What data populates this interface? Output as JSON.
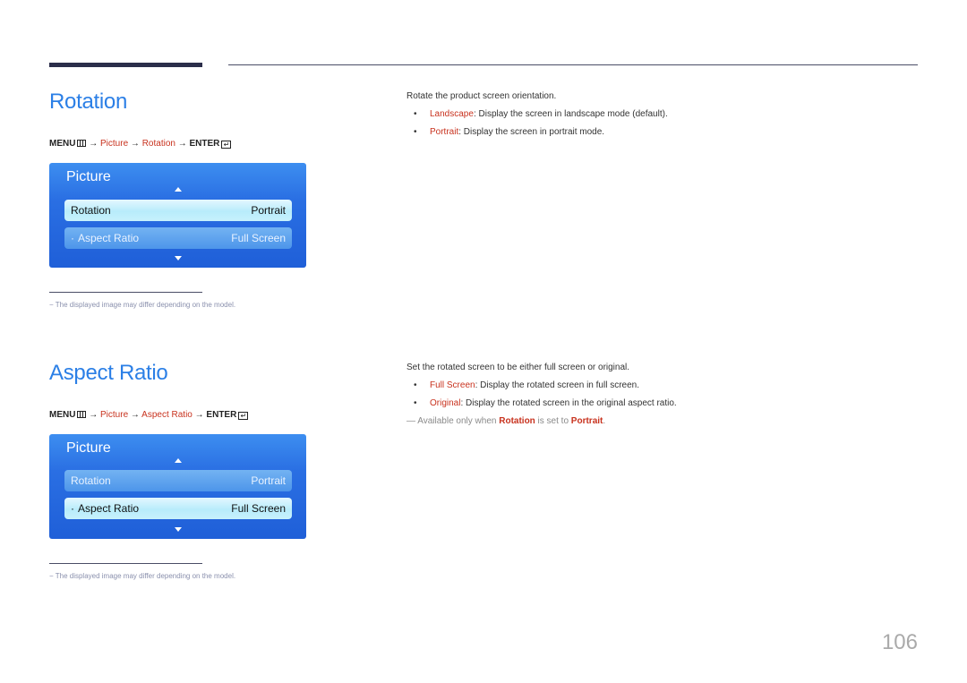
{
  "sections": {
    "rotation": {
      "title": "Rotation",
      "path": {
        "menu": "MENU",
        "arrow": "→",
        "picture": "Picture",
        "item": "Rotation",
        "enter": "ENTER"
      },
      "osd": {
        "title": "Picture",
        "rows": [
          {
            "label": "Rotation",
            "value": "Portrait",
            "selected": true
          },
          {
            "label": "Aspect Ratio",
            "value": "Full Screen",
            "selected": false
          }
        ]
      },
      "footnote": "The displayed image may differ depending on the model.",
      "description": "Rotate the product screen orientation.",
      "bullets": [
        {
          "term": "Landscape",
          "text": ": Display the screen in landscape mode (default)."
        },
        {
          "term": "Portrait",
          "text": ": Display the screen in portrait mode."
        }
      ]
    },
    "aspect_ratio": {
      "title": "Aspect Ratio",
      "path": {
        "menu": "MENU",
        "arrow": "→",
        "picture": "Picture",
        "item": "Aspect Ratio",
        "enter": "ENTER"
      },
      "osd": {
        "title": "Picture",
        "rows": [
          {
            "label": "Rotation",
            "value": "Portrait",
            "selected": false
          },
          {
            "label": "Aspect Ratio",
            "value": "Full Screen",
            "selected": true
          }
        ]
      },
      "footnote": "The displayed image may differ depending on the model.",
      "description": "Set the rotated screen to be either full screen or original.",
      "bullets": [
        {
          "term": "Full Screen",
          "text": ": Display the rotated screen in full screen."
        },
        {
          "term": "Original",
          "text": ": Display the rotated screen in the original aspect ratio."
        }
      ],
      "note": {
        "prefix": "Available only when ",
        "term1": "Rotation",
        "middle": " is set to ",
        "term2": "Portrait",
        "suffix": "."
      }
    }
  },
  "bullet_char": "•",
  "note_dash": "―",
  "row_dot": "·",
  "enter_glyph": "↵",
  "page_number": "106"
}
